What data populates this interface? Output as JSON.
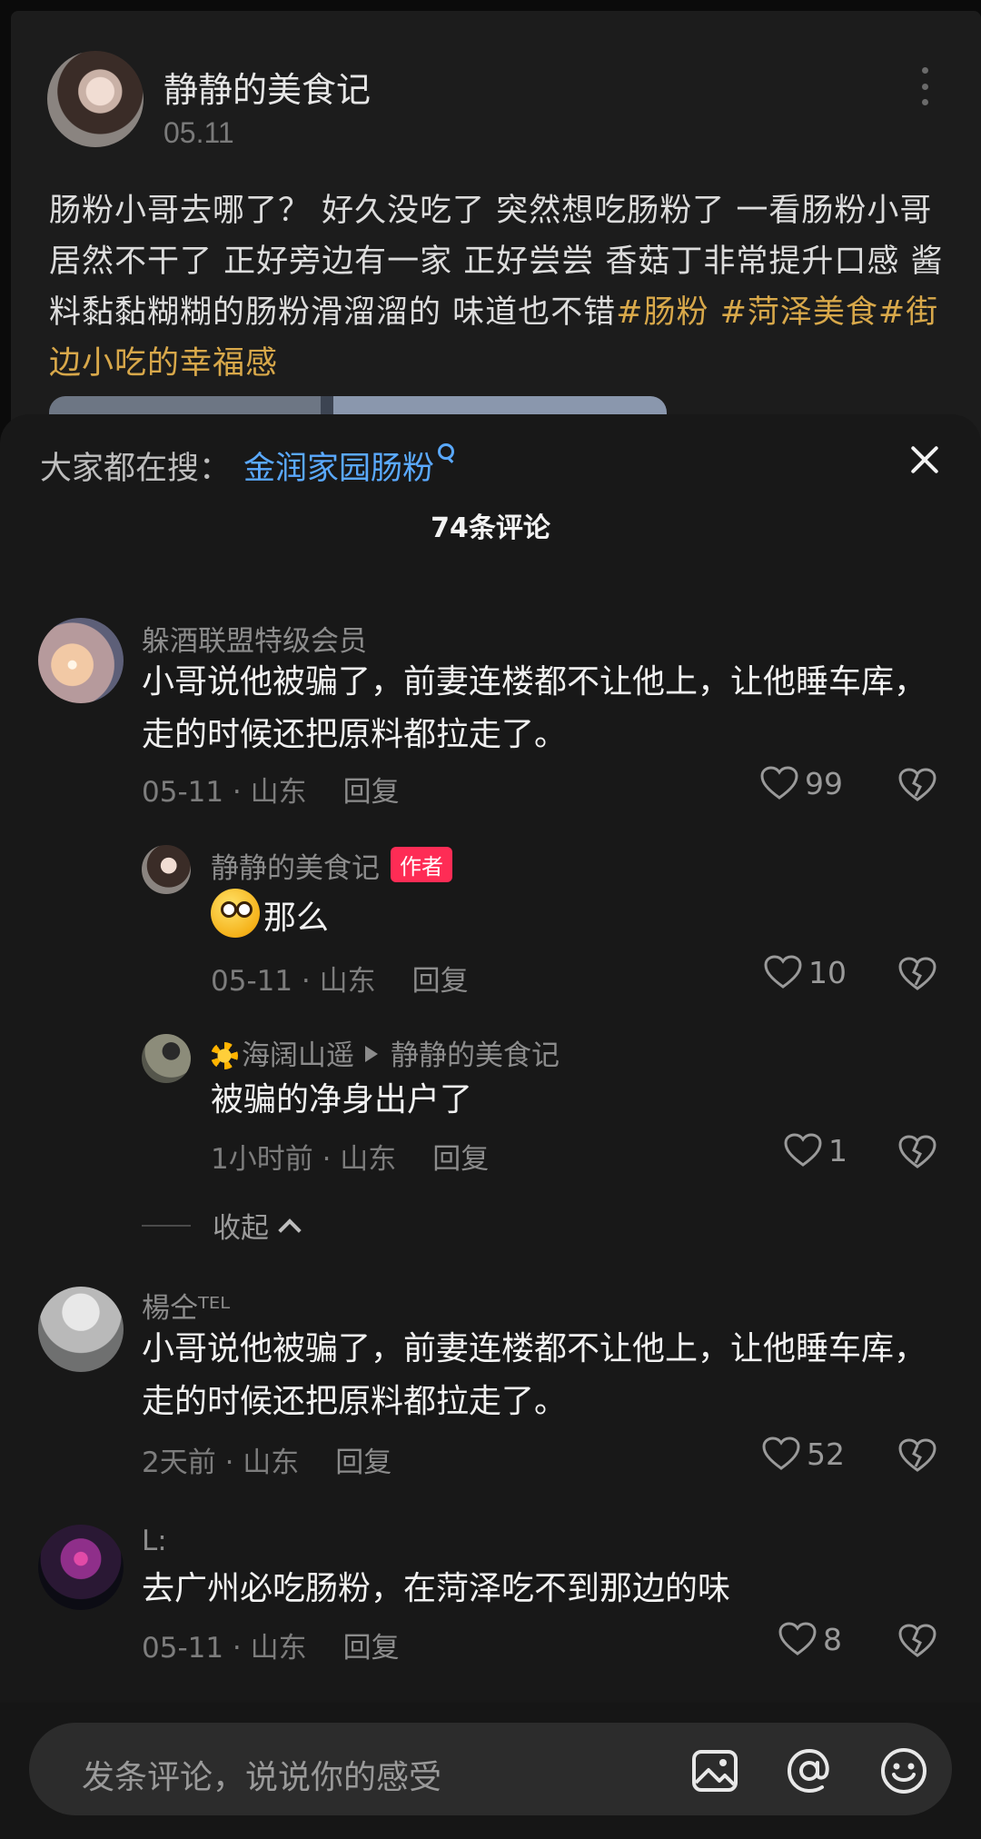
{
  "post": {
    "author": "静静的美食记",
    "date": "05.11",
    "body_text": "肠粉小哥去哪了？ 好久没吃了 突然想吃肠粉了 一看肠粉小哥居然不干了 正好旁边有一家 正好尝尝 香菇丁非常提升口感 酱料黏黏糊糊的肠粉滑溜溜的 味道也不错",
    "hashtags": "#肠粉 #菏泽美食#街边小吃的幸福感"
  },
  "sheet": {
    "search_label": "大家都在搜：",
    "search_query": "金润家园肠粉",
    "comment_count": "74条评论"
  },
  "comments": [
    {
      "user": "躲酒联盟特级会员",
      "text": "小哥说他被骗了，前妻连楼都不让他上，让他睡车库，走的时候还把原料都拉走了。",
      "time": "05-11 · 山东",
      "reply": "回复",
      "likes": "99"
    },
    {
      "user": "静静的美食记",
      "badge": "作者",
      "text": "那么",
      "time": "05-11 · 山东",
      "reply": "回复",
      "likes": "10"
    },
    {
      "user": "海阔山遥",
      "reply_to": "静静的美食记",
      "text": "被骗的净身出户了",
      "time": "1小时前 · 山东",
      "reply": "回复",
      "likes": "1"
    },
    {
      "user": "楊仝ᵀᴱᴸ",
      "text": "小哥说他被骗了，前妻连楼都不让他上，让他睡车库，走的时候还把原料都拉走了。",
      "time": "2天前 · 山东",
      "reply": "回复",
      "likes": "52"
    },
    {
      "user": "L:",
      "text": "去广州必吃肠粉，在菏泽吃不到那边的味",
      "time": "05-11 · 山东",
      "reply": "回复",
      "likes": "8"
    }
  ],
  "collapse_label": "收起",
  "input": {
    "placeholder": "发条评论，说说你的感受"
  },
  "colors": {
    "accent_link": "#5aa9ff",
    "hashtag": "#d8a84a",
    "author_badge": "#fe2c55",
    "sheet_bg": "#181818"
  }
}
